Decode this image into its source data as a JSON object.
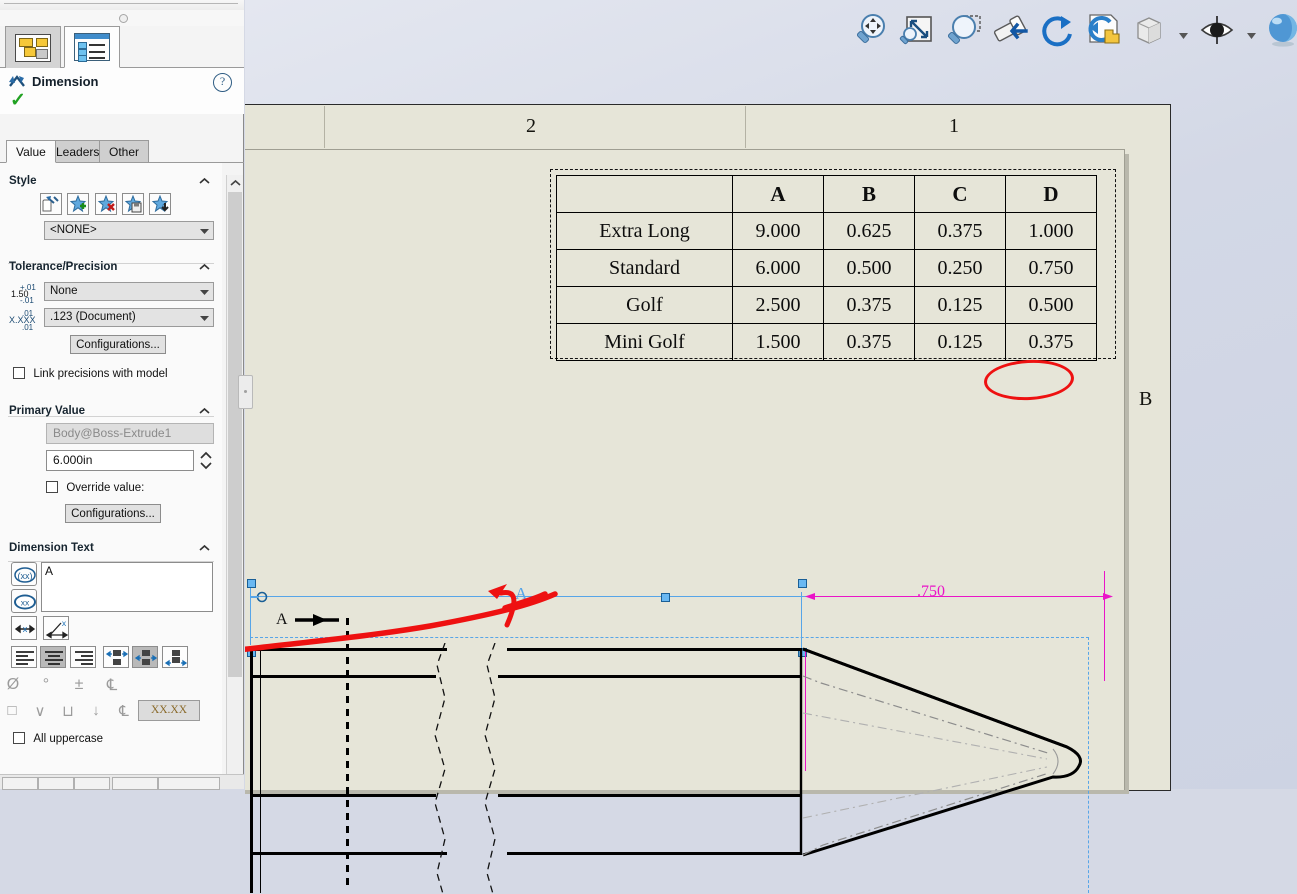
{
  "app": {
    "name": "SOLIDWORKS Drawing"
  },
  "panel": {
    "tabs_top": [
      {
        "name": "feature-manager-tab",
        "icon": "tree-icon"
      },
      {
        "name": "property-manager-tab",
        "icon": "list-icon"
      }
    ],
    "header": {
      "title": "Dimension",
      "help_icon": "question-mark-icon",
      "ok_icon": "green-check-icon"
    },
    "tabs": [
      {
        "label": "Value",
        "selected": true
      },
      {
        "label": "Leaders",
        "selected": false
      },
      {
        "label": "Other",
        "selected": false
      }
    ],
    "style": {
      "heading": "Style",
      "buttons": [
        {
          "name": "apply-default-style-icon"
        },
        {
          "name": "add-style-icon"
        },
        {
          "name": "delete-style-icon"
        },
        {
          "name": "save-style-icon"
        },
        {
          "name": "load-style-icon"
        }
      ],
      "select_value": "<NONE>"
    },
    "tolerance": {
      "heading": "Tolerance/Precision",
      "tolerance_type": "None",
      "tolerance_icon_text": "1.50",
      "tolerance_icon_top": "+.01",
      "tolerance_icon_bot": "-.01",
      "precision_value": ".123 (Document)",
      "precision_icon_text": "X.XXX",
      "precision_icon_top": ".01",
      "precision_icon_bot": ".01",
      "configurations_label": "Configurations...",
      "link_precision_label": "Link precisions with model",
      "link_precision_checked": false
    },
    "primary_value": {
      "heading": "Primary Value",
      "name_field": "Body@Boss-Extrude1",
      "value_field": "6.000in",
      "override_label": "Override value:",
      "override_checked": false,
      "configurations_label": "Configurations..."
    },
    "dimension_text": {
      "heading": "Dimension Text",
      "text_value": "A",
      "symbol_buttons": [
        {
          "name": "add-parenthesis-icon",
          "label": "(XX)"
        },
        {
          "name": "inspection-dim-icon",
          "label": "XX"
        }
      ],
      "offset_buttons": [
        {
          "name": "offset-text-icon",
          "label": "X"
        },
        {
          "name": "dimension-slant-icon",
          "label": "X"
        }
      ],
      "align_buttons": [
        {
          "name": "align-left-icon",
          "active": false
        },
        {
          "name": "align-center-icon",
          "active": true
        },
        {
          "name": "align-right-icon",
          "active": false
        },
        {
          "name": "text-above-icon",
          "active": false
        },
        {
          "name": "text-center-icon",
          "active": true
        },
        {
          "name": "text-below-icon",
          "active": false
        }
      ],
      "symbol_row_1": [
        {
          "name": "diameter-symbol-icon",
          "glyph": "Ø"
        },
        {
          "name": "degree-symbol-icon",
          "glyph": "°"
        },
        {
          "name": "plus-minus-symbol-icon",
          "glyph": "±"
        },
        {
          "name": "centerline-symbol-icon",
          "glyph": "℄"
        }
      ],
      "symbol_row_2": [
        {
          "name": "square-symbol-icon",
          "glyph": "□"
        },
        {
          "name": "countersink-symbol-icon",
          "glyph": "∨"
        },
        {
          "name": "counterbore-symbol-icon",
          "glyph": "⊔"
        },
        {
          "name": "depth-symbol-icon",
          "glyph": "↓"
        },
        {
          "name": "more-symbols-icon",
          "glyph": "℄"
        }
      ],
      "format_sample": "XX.XX",
      "all_uppercase_label": "All uppercase",
      "all_uppercase_checked": false
    }
  },
  "toolbar": {
    "buttons": [
      {
        "name": "zoom-to-area-icon",
        "label": "Zoom to Area"
      },
      {
        "name": "zoom-to-fit-icon",
        "label": "Zoom to Fit"
      },
      {
        "name": "zoom-in-out-icon",
        "label": "Zoom In/Out"
      },
      {
        "name": "previous-view-icon",
        "label": "Previous View"
      },
      {
        "name": "rotate-view-icon",
        "label": "Rotate View"
      },
      {
        "name": "update-view-icon",
        "label": "Update View"
      },
      {
        "name": "view-orientation-icon",
        "label": "View Orientation"
      },
      {
        "name": "display-style-icon",
        "label": "Display Style"
      },
      {
        "name": "hide-show-items-icon",
        "label": "Hide/Show Items"
      },
      {
        "name": "apply-scene-icon",
        "label": "Apply Scene"
      }
    ]
  },
  "sheet": {
    "zone_labels_top": [
      "2",
      "1"
    ],
    "zone_label_right": "B",
    "table": {
      "headers": [
        "",
        "A",
        "B",
        "C",
        "D"
      ],
      "rows": [
        {
          "label": "Extra Long",
          "values": [
            "9.000",
            "0.625",
            "0.375",
            "1.000"
          ]
        },
        {
          "label": "Standard",
          "values": [
            "6.000",
            "0.500",
            "0.250",
            "0.750"
          ]
        },
        {
          "label": "Golf",
          "values": [
            "2.500",
            "0.375",
            "0.125",
            "0.500"
          ]
        },
        {
          "label": "Mini Golf",
          "values": [
            "1.500",
            "0.375",
            "0.125",
            "0.375"
          ]
        }
      ],
      "highlighted_cell": "6.000",
      "highlight_color": "#ee1111"
    },
    "annotations": {
      "dimension_label_A": "A",
      "section_label_A": "A",
      "magenta_dimension": ".750",
      "dimension_color": "#57a5e8",
      "magenta_color": "#ea14c8"
    }
  }
}
